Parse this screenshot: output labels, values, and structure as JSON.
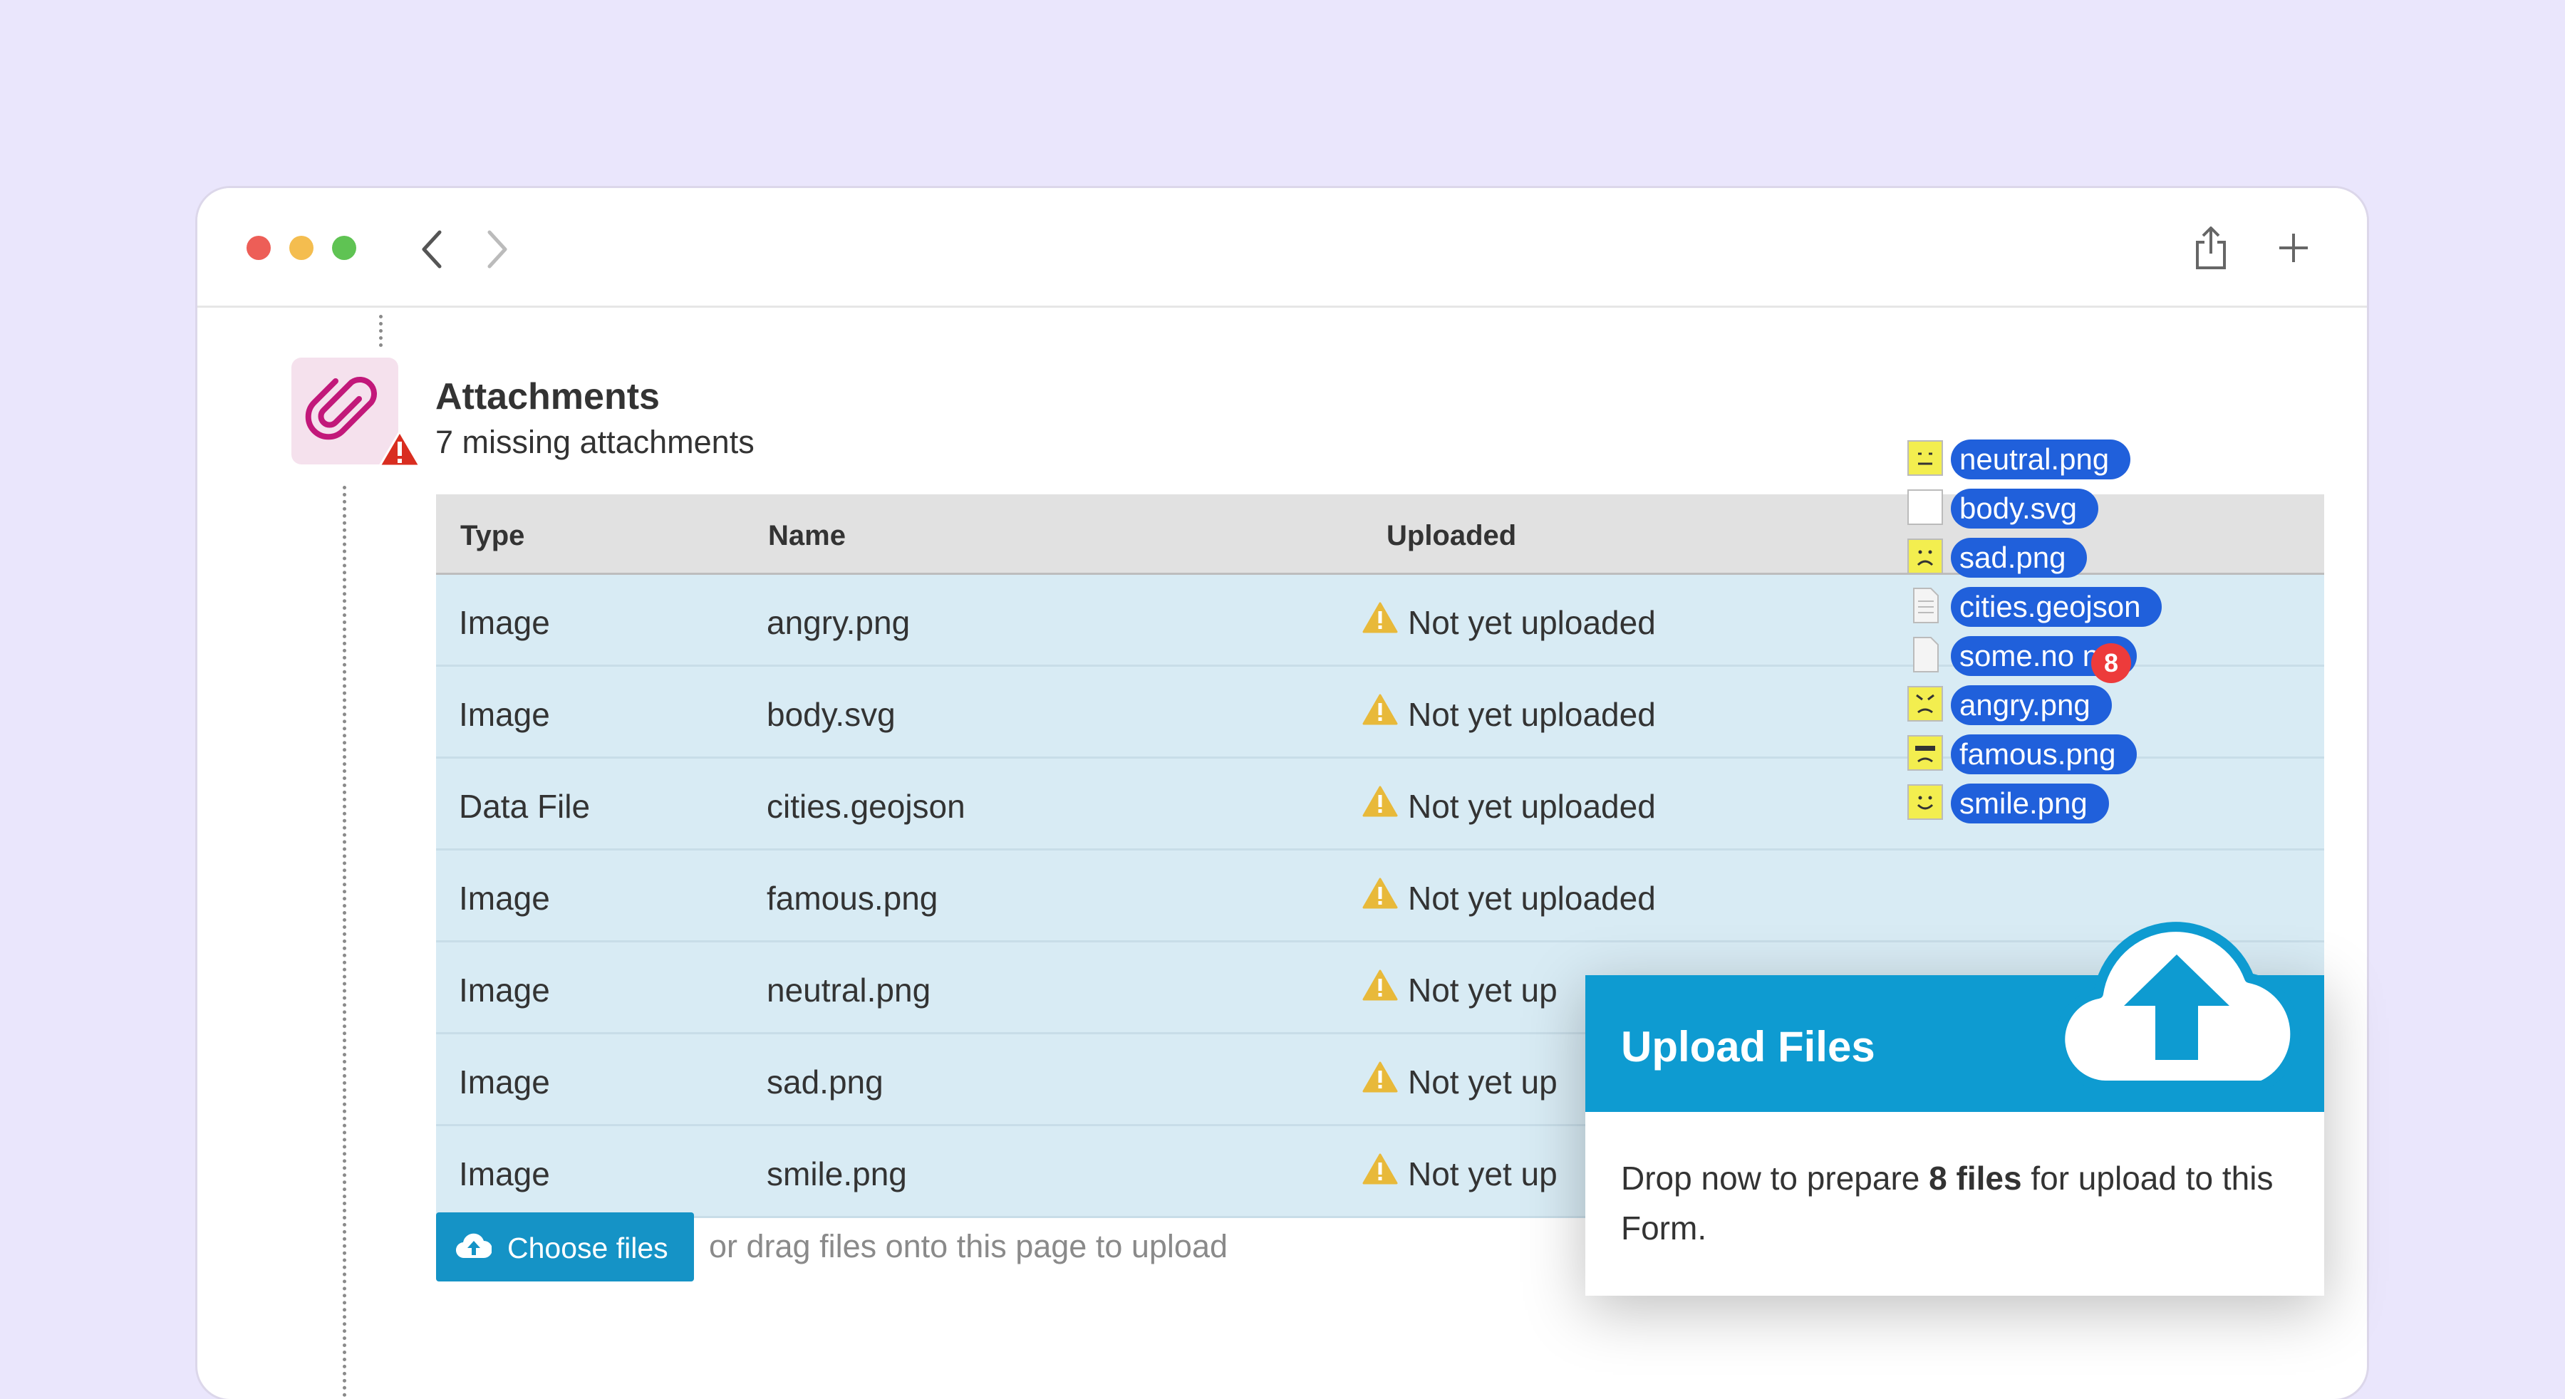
{
  "attachments": {
    "title": "Attachments",
    "subtitle": "7 missing attachments"
  },
  "table": {
    "headers": [
      "Type",
      "Name",
      "Uploaded"
    ],
    "rows": [
      {
        "type": "Image",
        "name": "angry.png",
        "status": "Not yet uploaded"
      },
      {
        "type": "Image",
        "name": "body.svg",
        "status": "Not yet uploaded"
      },
      {
        "type": "Data File",
        "name": "cities.geojson",
        "status": "Not yet uploaded"
      },
      {
        "type": "Image",
        "name": "famous.png",
        "status": "Not yet uploaded"
      },
      {
        "type": "Image",
        "name": "neutral.png",
        "status": "Not yet up"
      },
      {
        "type": "Image",
        "name": "sad.png",
        "status": "Not yet up"
      },
      {
        "type": "Image",
        "name": "smile.png",
        "status": "Not yet up"
      }
    ]
  },
  "upload": {
    "choose_label": "Choose files",
    "drag_hint": "or drag files onto this page to upload"
  },
  "upload_panel": {
    "title": "Upload Files",
    "body_prefix": "Drop now to prepare ",
    "body_bold": "8 files",
    "body_suffix": " for upload to this Form."
  },
  "dragged_files": {
    "count": "8",
    "items": [
      {
        "name": "neutral.png",
        "face": "neutral"
      },
      {
        "name": "body.svg",
        "face": "blank"
      },
      {
        "name": "sad.png",
        "face": "sad"
      },
      {
        "name": "cities.geojson",
        "face": "doc"
      },
      {
        "name": "some.no   ne",
        "face": "doc-blank"
      },
      {
        "name": "angry.png",
        "face": "angry"
      },
      {
        "name": "famous.png",
        "face": "famous"
      },
      {
        "name": "smile.png",
        "face": "smile"
      }
    ]
  },
  "colors": {
    "accent": "#1593c6",
    "panel_header": "#0e9bd1",
    "row_bg": "#d8ebf4",
    "warning": "#e8b93a",
    "error": "#d92d20",
    "drag_pill": "#2060db",
    "badge": "#ed3b3b"
  }
}
